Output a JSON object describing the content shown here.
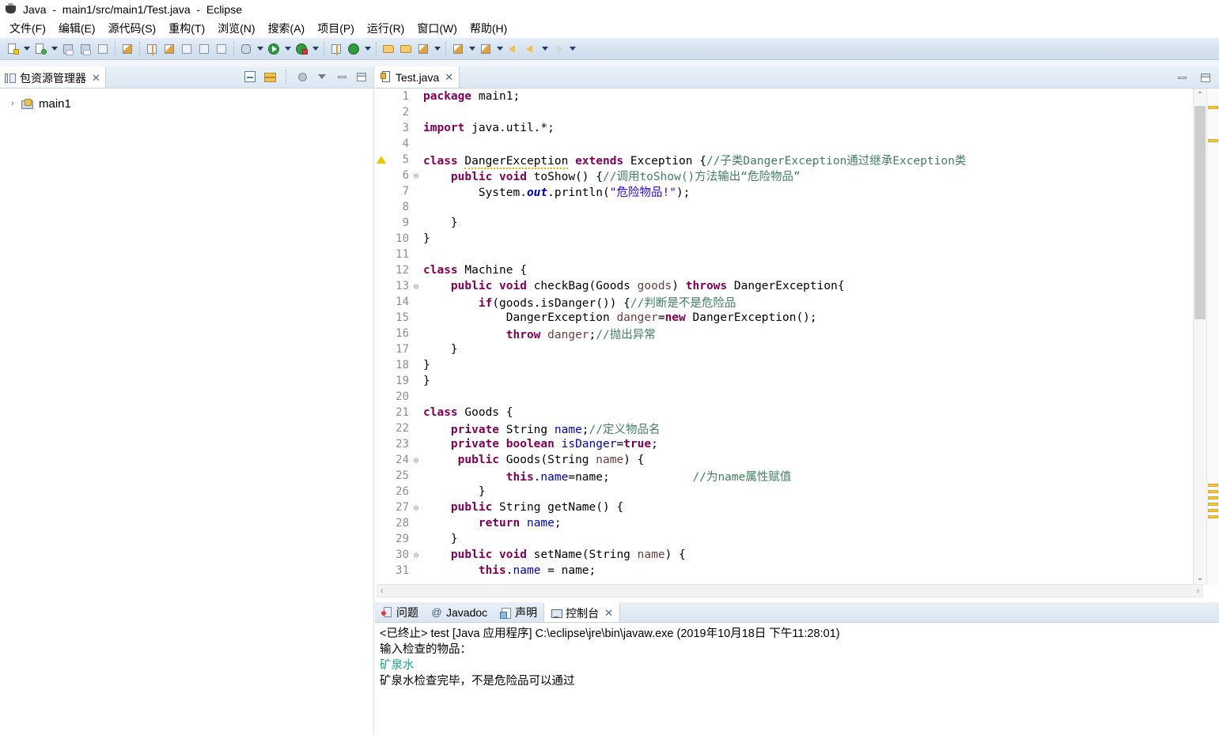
{
  "window": {
    "title": "Java  -  main1/src/main1/Test.java  -  Eclipse",
    "app_icon": "java-cup-icon"
  },
  "menubar": {
    "items": [
      {
        "label": "文件(F)",
        "name": "menu-file"
      },
      {
        "label": "编辑(E)",
        "name": "menu-edit"
      },
      {
        "label": "源代码(S)",
        "name": "menu-source"
      },
      {
        "label": "重构(T)",
        "name": "menu-refactor"
      },
      {
        "label": "浏览(N)",
        "name": "menu-navigate"
      },
      {
        "label": "搜索(A)",
        "name": "menu-search"
      },
      {
        "label": "项目(P)",
        "name": "menu-project"
      },
      {
        "label": "运行(R)",
        "name": "menu-run"
      },
      {
        "label": "窗口(W)",
        "name": "menu-window"
      },
      {
        "label": "帮助(H)",
        "name": "menu-help"
      }
    ]
  },
  "toolbar": {
    "groups": [
      [
        "new-wizard-icon",
        "dropdown",
        "new-java-class-icon",
        "dropdown"
      ],
      [
        "save-icon",
        "save-all-icon",
        "print-icon"
      ],
      [
        "toggle-breakpoint-icon"
      ],
      [
        "build-icon",
        "run-last-icon",
        "external-tools-icon",
        "new-java-project-icon",
        "table-icon"
      ],
      [
        "debug-icon",
        "dropdown",
        "run-icon",
        "dropdown",
        "run-config-icon",
        "dropdown"
      ],
      [
        "new-package-icon",
        "refresh-icon",
        "dropdown"
      ],
      [
        "open-type-icon",
        "open-task-icon",
        "annotate-icon",
        "dropdown"
      ],
      [
        "search-icon",
        "dropdown",
        "last-edit-icon",
        "dropdown"
      ],
      [
        "back-icon",
        "prev-icon",
        "dropdown",
        "forward-icon",
        "dropdown"
      ]
    ]
  },
  "explorer": {
    "tab_label": "包资源管理器",
    "tab_icon": "package-explorer-icon",
    "close_label": "✕",
    "tools": [
      {
        "name": "collapse-all-icon"
      },
      {
        "name": "link-with-editor-icon"
      },
      {
        "name": "view-focus-icon"
      },
      {
        "name": "view-menu-icon"
      },
      {
        "name": "minimize-icon"
      },
      {
        "name": "maximize-icon"
      }
    ],
    "tree": [
      {
        "label": "main1",
        "twisty": "›",
        "icon": "java-project-icon"
      }
    ]
  },
  "editor": {
    "tab_label": "Test.java",
    "tab_icon": "java-file-icon",
    "close_label": "✕",
    "tools": [
      {
        "name": "minimize-icon"
      },
      {
        "name": "maximize-icon"
      }
    ],
    "scroll": {
      "up_glyph": "⌃",
      "down_glyph": "⌄",
      "left_glyph": "‹",
      "right_glyph": "›"
    },
    "lines": [
      {
        "n": "1",
        "fold": "",
        "warn": false,
        "tokens": [
          {
            "t": "package ",
            "c": "kw"
          },
          {
            "t": "main1;",
            "c": "plain"
          }
        ]
      },
      {
        "n": "2",
        "fold": "",
        "warn": false,
        "tokens": []
      },
      {
        "n": "3",
        "fold": "",
        "warn": false,
        "tokens": [
          {
            "t": "import ",
            "c": "kw"
          },
          {
            "t": "java.util.*;",
            "c": "plain"
          }
        ]
      },
      {
        "n": "4",
        "fold": "",
        "warn": false,
        "tokens": []
      },
      {
        "n": "5",
        "fold": "",
        "warn": true,
        "tokens": [
          {
            "t": "class ",
            "c": "kw"
          },
          {
            "t": "DangerException",
            "c": "squigplain"
          },
          {
            "t": " ",
            "c": "plain"
          },
          {
            "t": "extends",
            "c": "kw"
          },
          {
            "t": " Exception {",
            "c": "plain"
          },
          {
            "t": "//子类DangerException通过继承Exception类",
            "c": "cmt"
          }
        ]
      },
      {
        "n": "6",
        "fold": "⊖",
        "warn": false,
        "tokens": [
          {
            "t": "    ",
            "c": "plain"
          },
          {
            "t": "public void",
            "c": "kw"
          },
          {
            "t": " toShow() {",
            "c": "plain"
          },
          {
            "t": "//调用toShow()方法输出“危险物品”",
            "c": "cmt"
          }
        ]
      },
      {
        "n": "7",
        "fold": "",
        "warn": false,
        "tokens": [
          {
            "t": "        System.",
            "c": "plain"
          },
          {
            "t": "out",
            "c": "stat"
          },
          {
            "t": ".println(",
            "c": "plain"
          },
          {
            "t": "\"危险物品!\"",
            "c": "str"
          },
          {
            "t": ");",
            "c": "plain"
          }
        ]
      },
      {
        "n": "8",
        "fold": "",
        "warn": false,
        "tokens": []
      },
      {
        "n": "9",
        "fold": "",
        "warn": false,
        "tokens": [
          {
            "t": "    }",
            "c": "plain"
          }
        ]
      },
      {
        "n": "10",
        "fold": "",
        "warn": false,
        "tokens": [
          {
            "t": "}",
            "c": "plain"
          }
        ]
      },
      {
        "n": "11",
        "fold": "",
        "warn": false,
        "tokens": []
      },
      {
        "n": "12",
        "fold": "",
        "warn": false,
        "tokens": [
          {
            "t": "class ",
            "c": "kw"
          },
          {
            "t": "Machine {",
            "c": "plain"
          }
        ]
      },
      {
        "n": "13",
        "fold": "⊖",
        "warn": false,
        "tokens": [
          {
            "t": "    ",
            "c": "plain"
          },
          {
            "t": "public void",
            "c": "kw"
          },
          {
            "t": " checkBag(Goods ",
            "c": "plain"
          },
          {
            "t": "goods",
            "c": "loc"
          },
          {
            "t": ") ",
            "c": "plain"
          },
          {
            "t": "throws",
            "c": "kw"
          },
          {
            "t": " DangerException{",
            "c": "plain"
          }
        ]
      },
      {
        "n": "14",
        "fold": "",
        "warn": false,
        "tokens": [
          {
            "t": "        ",
            "c": "plain"
          },
          {
            "t": "if",
            "c": "kw"
          },
          {
            "t": "(goods.isDanger()) {",
            "c": "plain"
          },
          {
            "t": "//判断是不是危险品",
            "c": "cmt"
          }
        ]
      },
      {
        "n": "15",
        "fold": "",
        "warn": false,
        "tokens": [
          {
            "t": "            DangerException ",
            "c": "plain"
          },
          {
            "t": "danger",
            "c": "loc"
          },
          {
            "t": "=",
            "c": "plain"
          },
          {
            "t": "new",
            "c": "kw"
          },
          {
            "t": " DangerException();",
            "c": "plain"
          }
        ]
      },
      {
        "n": "16",
        "fold": "",
        "warn": false,
        "tokens": [
          {
            "t": "            ",
            "c": "plain"
          },
          {
            "t": "throw",
            "c": "kw"
          },
          {
            "t": " ",
            "c": "plain"
          },
          {
            "t": "danger",
            "c": "loc"
          },
          {
            "t": ";",
            "c": "plain"
          },
          {
            "t": "//抛出异常",
            "c": "cmt"
          }
        ]
      },
      {
        "n": "17",
        "fold": "",
        "warn": false,
        "tokens": [
          {
            "t": "    }",
            "c": "plain"
          }
        ]
      },
      {
        "n": "18",
        "fold": "",
        "warn": false,
        "tokens": [
          {
            "t": "}",
            "c": "plain"
          }
        ]
      },
      {
        "n": "19",
        "fold": "",
        "warn": false,
        "tokens": [
          {
            "t": "}",
            "c": "plain"
          }
        ]
      },
      {
        "n": "20",
        "fold": "",
        "warn": false,
        "tokens": []
      },
      {
        "n": "21",
        "fold": "",
        "warn": false,
        "tokens": [
          {
            "t": "class ",
            "c": "kw"
          },
          {
            "t": "Goods {",
            "c": "plain"
          }
        ]
      },
      {
        "n": "22",
        "fold": "",
        "warn": false,
        "tokens": [
          {
            "t": "    ",
            "c": "plain"
          },
          {
            "t": "private",
            "c": "kw"
          },
          {
            "t": " String ",
            "c": "plain"
          },
          {
            "t": "name",
            "c": "fld"
          },
          {
            "t": ";",
            "c": "plain"
          },
          {
            "t": "//定义物品名",
            "c": "cmt"
          }
        ]
      },
      {
        "n": "23",
        "fold": "",
        "warn": false,
        "tokens": [
          {
            "t": "    ",
            "c": "plain"
          },
          {
            "t": "private boolean",
            "c": "kw"
          },
          {
            "t": " ",
            "c": "plain"
          },
          {
            "t": "isDanger",
            "c": "fld"
          },
          {
            "t": "=",
            "c": "plain"
          },
          {
            "t": "true",
            "c": "kw"
          },
          {
            "t": ";",
            "c": "plain"
          }
        ]
      },
      {
        "n": "24",
        "fold": "⊖",
        "warn": false,
        "tokens": [
          {
            "t": "     ",
            "c": "plain"
          },
          {
            "t": "public",
            "c": "kw"
          },
          {
            "t": " Goods(String ",
            "c": "plain"
          },
          {
            "t": "name",
            "c": "loc"
          },
          {
            "t": ") {",
            "c": "plain"
          }
        ]
      },
      {
        "n": "25",
        "fold": "",
        "warn": false,
        "tokens": [
          {
            "t": "            ",
            "c": "plain"
          },
          {
            "t": "this",
            "c": "kw"
          },
          {
            "t": ".",
            "c": "plain"
          },
          {
            "t": "name",
            "c": "fld"
          },
          {
            "t": "=name;            ",
            "c": "plain"
          },
          {
            "t": "//为name属性赋值",
            "c": "cmt"
          }
        ]
      },
      {
        "n": "26",
        "fold": "",
        "warn": false,
        "tokens": [
          {
            "t": "        }",
            "c": "plain"
          }
        ]
      },
      {
        "n": "27",
        "fold": "⊖",
        "warn": false,
        "tokens": [
          {
            "t": "    ",
            "c": "plain"
          },
          {
            "t": "public",
            "c": "kw"
          },
          {
            "t": " String getName() {",
            "c": "plain"
          }
        ]
      },
      {
        "n": "28",
        "fold": "",
        "warn": false,
        "tokens": [
          {
            "t": "        ",
            "c": "plain"
          },
          {
            "t": "return",
            "c": "kw"
          },
          {
            "t": " ",
            "c": "plain"
          },
          {
            "t": "name",
            "c": "fld"
          },
          {
            "t": ";",
            "c": "plain"
          }
        ]
      },
      {
        "n": "29",
        "fold": "",
        "warn": false,
        "tokens": [
          {
            "t": "    }",
            "c": "plain"
          }
        ]
      },
      {
        "n": "30",
        "fold": "⊖",
        "warn": false,
        "tokens": [
          {
            "t": "    ",
            "c": "plain"
          },
          {
            "t": "public void",
            "c": "kw"
          },
          {
            "t": " setName(String ",
            "c": "plain"
          },
          {
            "t": "name",
            "c": "loc"
          },
          {
            "t": ") {",
            "c": "plain"
          }
        ]
      },
      {
        "n": "31",
        "fold": "",
        "warn": false,
        "tokens": [
          {
            "t": "        ",
            "c": "plain"
          },
          {
            "t": "this",
            "c": "kw"
          },
          {
            "t": ".",
            "c": "plain"
          },
          {
            "t": "name",
            "c": "fld"
          },
          {
            "t": " = name;",
            "c": "plain"
          }
        ]
      }
    ],
    "ruler_marks": [
      22,
      64,
      500,
      508,
      516,
      524,
      532,
      540
    ]
  },
  "console": {
    "tabs": [
      {
        "label": "问题",
        "icon": "problems-icon",
        "active": false,
        "name": "tab-problems"
      },
      {
        "label": "Javadoc",
        "icon": "javadoc-icon",
        "active": false,
        "name": "tab-javadoc"
      },
      {
        "label": "声明",
        "icon": "declaration-icon",
        "active": false,
        "name": "tab-declaration"
      },
      {
        "label": "控制台",
        "icon": "console-icon",
        "active": true,
        "name": "tab-console"
      }
    ],
    "close_label": "✕",
    "header": "<已终止> test [Java 应用程序] C:\\eclipse\\jre\\bin\\javaw.exe  (2019年10月18日 下午11:28:01)",
    "output": [
      {
        "text": "输入检查的物品：",
        "kind": "stdout"
      },
      {
        "text": "矿泉水",
        "kind": "stdin"
      },
      {
        "text": "矿泉水检查完毕，不是危险品可以通过",
        "kind": "stdout"
      }
    ]
  },
  "colors": {
    "keyword": "#7f0055",
    "comment": "#3f7f5f",
    "string": "#2a00ff",
    "field": "#0000c0",
    "local": "#6a3e3e",
    "console_input": "#17a589",
    "warning_marker": "#f2c84b",
    "toolbar_bg": "#d6e3f0"
  }
}
